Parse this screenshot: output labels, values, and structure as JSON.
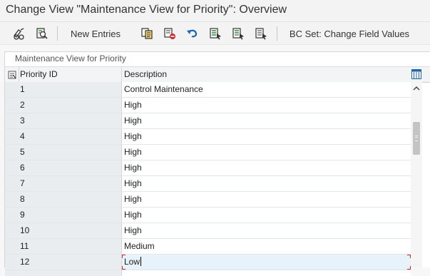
{
  "window": {
    "title": "Change View \"Maintenance View for Priority\": Overview"
  },
  "toolbar": {
    "new_entries_label": "New Entries",
    "bc_set_label": "BC Set: Change Field Values",
    "icons": [
      "display-change-icon",
      "where-used-icon",
      "copy-icon",
      "delete-icon",
      "undo-icon",
      "select-all-icon",
      "select-block-icon",
      "deselect-all-icon"
    ]
  },
  "panel": {
    "title": "Maintenance View for Priority"
  },
  "table": {
    "headers": {
      "priority_id": "Priority ID",
      "description": "Description"
    },
    "rows": [
      {
        "id": "1",
        "description": "Control Maintenance"
      },
      {
        "id": "2",
        "description": "High"
      },
      {
        "id": "3",
        "description": "High"
      },
      {
        "id": "4",
        "description": "High"
      },
      {
        "id": "5",
        "description": "High"
      },
      {
        "id": "6",
        "description": "High"
      },
      {
        "id": "7",
        "description": "High"
      },
      {
        "id": "8",
        "description": "High"
      },
      {
        "id": "9",
        "description": "High"
      },
      {
        "id": "10",
        "description": "High"
      },
      {
        "id": "11",
        "description": "Medium"
      },
      {
        "id": "12",
        "description": "Low"
      }
    ],
    "active_row_index": 11
  },
  "colors": {
    "accent_blue": "#1a66b3",
    "green": "#2e8b3a",
    "red": "#cc2a2a"
  }
}
